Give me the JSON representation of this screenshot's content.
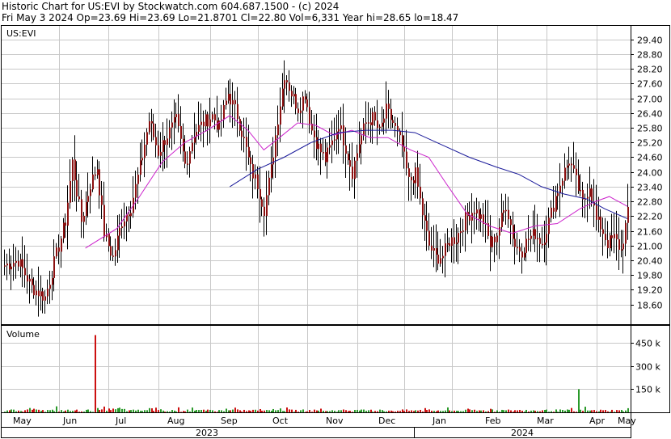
{
  "header": {
    "line1": "Historic Chart for US:EVI by Stockwatch.com 604.687.1500 - (c) 2024",
    "line2": "Fri May  3 2024   Op=23.69   Hi=23.69   Lo=21.8701   Cl=22.80   Vol=6,331   Year hi=28.65   lo=18.47"
  },
  "chart_data": {
    "type": "ohlc",
    "symbol": "US:EVI",
    "price_axis": {
      "ticks": [
        "29.40",
        "28.80",
        "28.20",
        "27.60",
        "27.00",
        "26.40",
        "25.80",
        "25.20",
        "24.60",
        "24.00",
        "23.40",
        "22.80",
        "22.20",
        "21.60",
        "21.00",
        "20.40",
        "19.80",
        "19.20",
        "18.60"
      ],
      "ylim": [
        17.8,
        29.95
      ]
    },
    "volume_axis": {
      "label": "Volume",
      "ticks": [
        "450 k",
        "300 k",
        "150 k"
      ],
      "ylim": [
        0,
        560000
      ]
    },
    "months": [
      "May",
      "Jun",
      "Jul",
      "Aug",
      "Sep",
      "Oct",
      "Nov",
      "Dec",
      "Jan",
      "Feb",
      "Mar",
      "Apr",
      "May"
    ],
    "years": [
      "2023",
      "2024"
    ],
    "colors": {
      "bar": "#8b1010",
      "wick": "#000000",
      "ma_short": "#cc22cc",
      "ma_long": "#1a1a9a",
      "vol_up": "#2a9a2a",
      "vol_down": "#cc1010",
      "grid": "#c8c8c8"
    },
    "close_keyframes": [
      [
        0,
        20.2
      ],
      [
        6,
        20.4
      ],
      [
        12,
        19.3
      ],
      [
        18,
        18.9
      ],
      [
        22,
        20.3
      ],
      [
        27,
        22.0
      ],
      [
        30,
        24.4
      ],
      [
        34,
        22.0
      ],
      [
        38,
        23.5
      ],
      [
        41,
        24.2
      ],
      [
        44,
        21.5
      ],
      [
        48,
        20.5
      ],
      [
        52,
        22.0
      ],
      [
        56,
        22.6
      ],
      [
        60,
        24.2
      ],
      [
        64,
        26.1
      ],
      [
        68,
        24.8
      ],
      [
        72,
        25.5
      ],
      [
        76,
        26.1
      ],
      [
        80,
        24.3
      ],
      [
        84,
        25.6
      ],
      [
        88,
        26.0
      ],
      [
        92,
        26.3
      ],
      [
        95,
        25.8
      ],
      [
        99,
        27.2
      ],
      [
        103,
        26.3
      ],
      [
        106,
        25.3
      ],
      [
        109,
        24.1
      ],
      [
        112,
        23.5
      ],
      [
        115,
        22.5
      ],
      [
        118,
        24.1
      ],
      [
        121,
        26.2
      ],
      [
        124,
        28.0
      ],
      [
        127,
        27.2
      ],
      [
        130,
        26.6
      ],
      [
        133,
        27.2
      ],
      [
        136,
        25.7
      ],
      [
        139,
        25.0
      ],
      [
        142,
        24.5
      ],
      [
        145,
        25.2
      ],
      [
        148,
        26.0
      ],
      [
        151,
        25.0
      ],
      [
        154,
        24.0
      ],
      [
        157,
        25.2
      ],
      [
        160,
        26.0
      ],
      [
        163,
        26.2
      ],
      [
        166,
        25.6
      ],
      [
        169,
        26.5
      ],
      [
        172,
        26.0
      ],
      [
        176,
        25.0
      ],
      [
        179,
        23.6
      ],
      [
        182,
        23.9
      ],
      [
        185,
        22.3
      ],
      [
        188,
        21.0
      ],
      [
        191,
        20.5
      ],
      [
        194,
        20.6
      ],
      [
        197,
        21.2
      ],
      [
        200,
        21.3
      ],
      [
        204,
        22.1
      ],
      [
        208,
        22.5
      ],
      [
        212,
        22.0
      ],
      [
        215,
        21.0
      ],
      [
        218,
        21.5
      ],
      [
        222,
        22.7
      ],
      [
        226,
        21.0
      ],
      [
        229,
        20.8
      ],
      [
        232,
        21.3
      ],
      [
        235,
        21.5
      ],
      [
        238,
        21.1
      ],
      [
        241,
        22.0
      ],
      [
        244,
        23.0
      ],
      [
        247,
        23.8
      ],
      [
        250,
        24.5
      ],
      [
        253,
        23.6
      ],
      [
        256,
        22.7
      ],
      [
        259,
        23.5
      ],
      [
        262,
        22.0
      ],
      [
        264,
        21.8
      ],
      [
        267,
        21.1
      ],
      [
        270,
        21.3
      ],
      [
        273,
        20.8
      ],
      [
        276,
        22.3
      ]
    ],
    "spikes": {
      "vol_big": [
        [
          40,
          500000
        ]
      ],
      "vol_green": [
        [
          254,
          150000
        ]
      ]
    },
    "ma_short_points": [
      [
        36,
        20.9
      ],
      [
        50,
        21.7
      ],
      [
        60,
        23.0
      ],
      [
        70,
        24.4
      ],
      [
        80,
        25.2
      ],
      [
        90,
        25.7
      ],
      [
        100,
        26.3
      ],
      [
        108,
        25.7
      ],
      [
        115,
        24.9
      ],
      [
        122,
        25.4
      ],
      [
        130,
        26.0
      ],
      [
        138,
        25.9
      ],
      [
        146,
        25.5
      ],
      [
        154,
        25.7
      ],
      [
        162,
        25.4
      ],
      [
        170,
        25.4
      ],
      [
        180,
        24.9
      ],
      [
        188,
        24.6
      ],
      [
        196,
        23.5
      ],
      [
        205,
        22.3
      ],
      [
        215,
        21.8
      ],
      [
        225,
        21.5
      ],
      [
        235,
        21.8
      ],
      [
        245,
        21.9
      ],
      [
        255,
        22.5
      ],
      [
        262,
        22.8
      ],
      [
        268,
        23.0
      ],
      [
        276,
        22.6
      ]
    ],
    "ma_long_points": [
      [
        100,
        23.4
      ],
      [
        112,
        24.1
      ],
      [
        124,
        24.6
      ],
      [
        136,
        25.2
      ],
      [
        148,
        25.6
      ],
      [
        160,
        25.7
      ],
      [
        172,
        25.7
      ],
      [
        182,
        25.6
      ],
      [
        194,
        25.1
      ],
      [
        206,
        24.6
      ],
      [
        218,
        24.2
      ],
      [
        228,
        23.9
      ],
      [
        238,
        23.4
      ],
      [
        248,
        23.1
      ],
      [
        258,
        22.9
      ],
      [
        266,
        22.5
      ],
      [
        276,
        22.1
      ]
    ]
  }
}
